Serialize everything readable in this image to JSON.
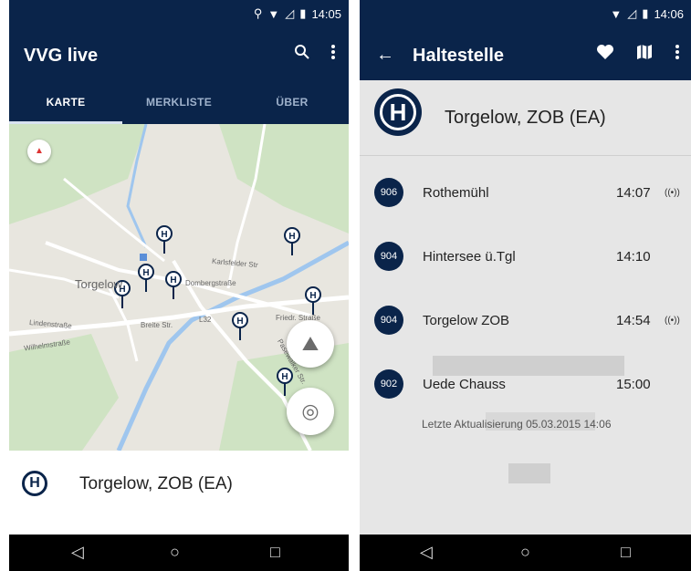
{
  "left": {
    "status": {
      "time": "14:05"
    },
    "appbar": {
      "title": "VVG live",
      "search_icon": "search-icon",
      "menu_icon": "more-vert-icon"
    },
    "tabs": [
      {
        "label": "KARTE",
        "active": true
      },
      {
        "label": "MERKLISTE",
        "active": false
      },
      {
        "label": "ÜBER",
        "active": false
      }
    ],
    "map": {
      "labels": {
        "torgelow": "Torgelow",
        "karlsfelder": "Karlsfelder Str",
        "domberg": "Dombergstraße",
        "linden": "Lindenstraße",
        "wilhelm": "Wilhelmstraße",
        "breite": "Breite Str.",
        "l32": "L32",
        "friedr": "Friedr. Straße",
        "pasewalker": "Pasewalker Str."
      }
    },
    "selected_stop": {
      "name": "Torgelow, ZOB (EA)"
    }
  },
  "right": {
    "status": {
      "time": "14:06"
    },
    "appbar": {
      "title": "Haltestelle"
    },
    "stop": {
      "name": "Torgelow, ZOB (EA)",
      "icon_letter": "H"
    },
    "departures": [
      {
        "line": "906",
        "destination": "Rothemühl",
        "time": "14:07",
        "live": true
      },
      {
        "line": "904",
        "destination": "Hintersee ü.Tgl",
        "time": "14:10",
        "live": false
      },
      {
        "line": "904",
        "destination": "Torgelow ZOB",
        "time": "14:54",
        "live": true
      },
      {
        "line": "902",
        "destination": "Uede Chauss",
        "time": "15:00",
        "live": false
      }
    ],
    "last_update": "Letzte Aktualisierung 05.03.2015 14:06"
  },
  "colors": {
    "primary": "#0a244a",
    "map_bg": "#e8e6df",
    "water": "#9fc6ee",
    "park": "#cfe3c3"
  }
}
